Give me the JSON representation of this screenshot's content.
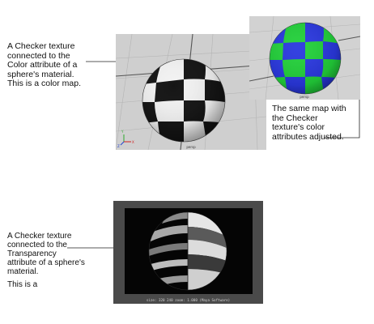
{
  "caption_color": {
    "lines": [
      "A Checker texture",
      "connected to the",
      "Color attribute of a",
      "sphere's material."
    ],
    "extra": "This is a color map."
  },
  "caption_adjusted": {
    "lines": [
      "The same map with",
      "the Checker",
      "texture's color",
      "attributes adjusted."
    ]
  },
  "caption_transparency": {
    "lines": [
      "A Checker texture",
      "connected to the",
      "Transparency",
      "attribute of a sphere's",
      "material."
    ],
    "extra": "This is a"
  },
  "viewport_main": {
    "camera_label": "persp",
    "axis_labels": {
      "y": "Y",
      "x": "X",
      "z": "Z"
    }
  },
  "viewport_inset": {
    "camera_label": "persp"
  },
  "render_view": {
    "status_text": "size: 320 240 zoom: 1.000 (Maya Software)"
  },
  "colors": {
    "checker_dark": "#151515",
    "checker_light": "#f2f2f2",
    "checker_green": "#22d13a",
    "checker_blue": "#2a38e0",
    "viewport_bg": "#cfcfcf",
    "render_frame": "#4a4a4a"
  }
}
